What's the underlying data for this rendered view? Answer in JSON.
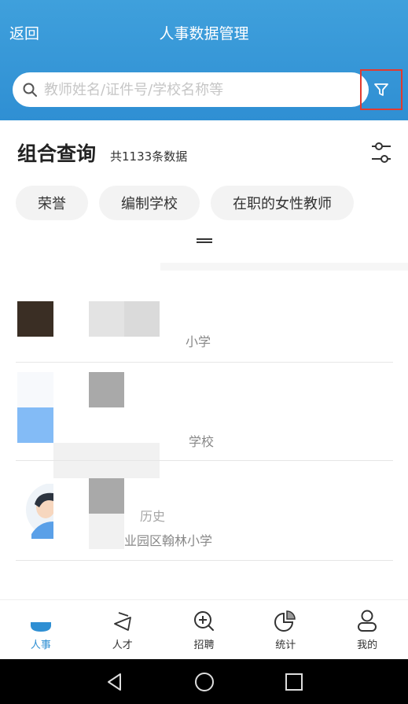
{
  "header": {
    "back_label": "返回",
    "title": "人事数据管理"
  },
  "search": {
    "placeholder": "教师姓名/证件号/学校名称等",
    "value": ""
  },
  "query": {
    "title": "组合查询",
    "count_text": "共1133条数据"
  },
  "chips": [
    {
      "label": "荣誉"
    },
    {
      "label": "编制学校"
    },
    {
      "label": "在职的女性教师"
    }
  ],
  "list": {
    "items": [
      {
        "school_partial": "小学"
      },
      {
        "school_partial": "学校"
      },
      {
        "subject_partial": "历史",
        "school_partial": "业园区翰林小学"
      }
    ]
  },
  "tabs": [
    {
      "label": "人事",
      "icon": "person-card-icon",
      "active": true
    },
    {
      "label": "人才",
      "icon": "graduation-cap-icon",
      "active": false
    },
    {
      "label": "招聘",
      "icon": "search-plus-icon",
      "active": false
    },
    {
      "label": "统计",
      "icon": "pie-chart-icon",
      "active": false
    },
    {
      "label": "我的",
      "icon": "user-icon",
      "active": false
    }
  ],
  "colors": {
    "header": "#2f8fd3",
    "accent": "#2f8fd3",
    "highlight_border": "#e23a2f"
  }
}
